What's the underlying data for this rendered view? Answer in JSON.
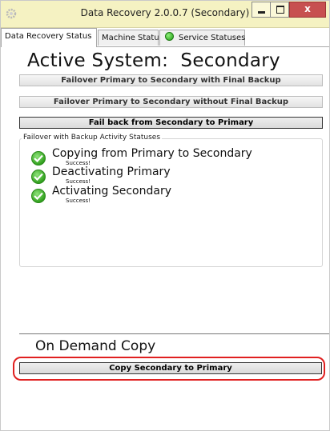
{
  "window": {
    "title": "Data Recovery 2.0.0.7 (Secondary)",
    "close_label": "x"
  },
  "tabs": [
    {
      "label": "Data Recovery Status",
      "active": true
    },
    {
      "label": "Machine Status",
      "active": false
    },
    {
      "label": "Service Statuses",
      "active": false,
      "status_color": "#22aa22"
    }
  ],
  "main": {
    "active_system_label": "Active System:",
    "active_system_value": "Secondary",
    "buttons": {
      "failover_with_backup": "Failover Primary to Secondary with Final Backup",
      "failover_without_backup": "Failover Primary to Secondary without Final Backup",
      "failback": "Fail back from Secondary to Primary"
    },
    "activity": {
      "legend": "Failover with Backup Activity Statuses",
      "items": [
        {
          "label": "Copying from Primary to Secondary",
          "result": "Success!",
          "icon": "check-icon"
        },
        {
          "label": "Deactivating Primary",
          "result": "Success!",
          "icon": "check-icon"
        },
        {
          "label": "Activating Secondary",
          "result": "Success!",
          "icon": "check-icon"
        }
      ]
    },
    "on_demand": {
      "heading": "On Demand Copy",
      "copy_button": "Copy Secondary to Primary"
    }
  },
  "colors": {
    "titlebar": "#f5f2c2",
    "close_button": "#c75050",
    "highlight": "#e02020",
    "success": "#33a21f"
  }
}
